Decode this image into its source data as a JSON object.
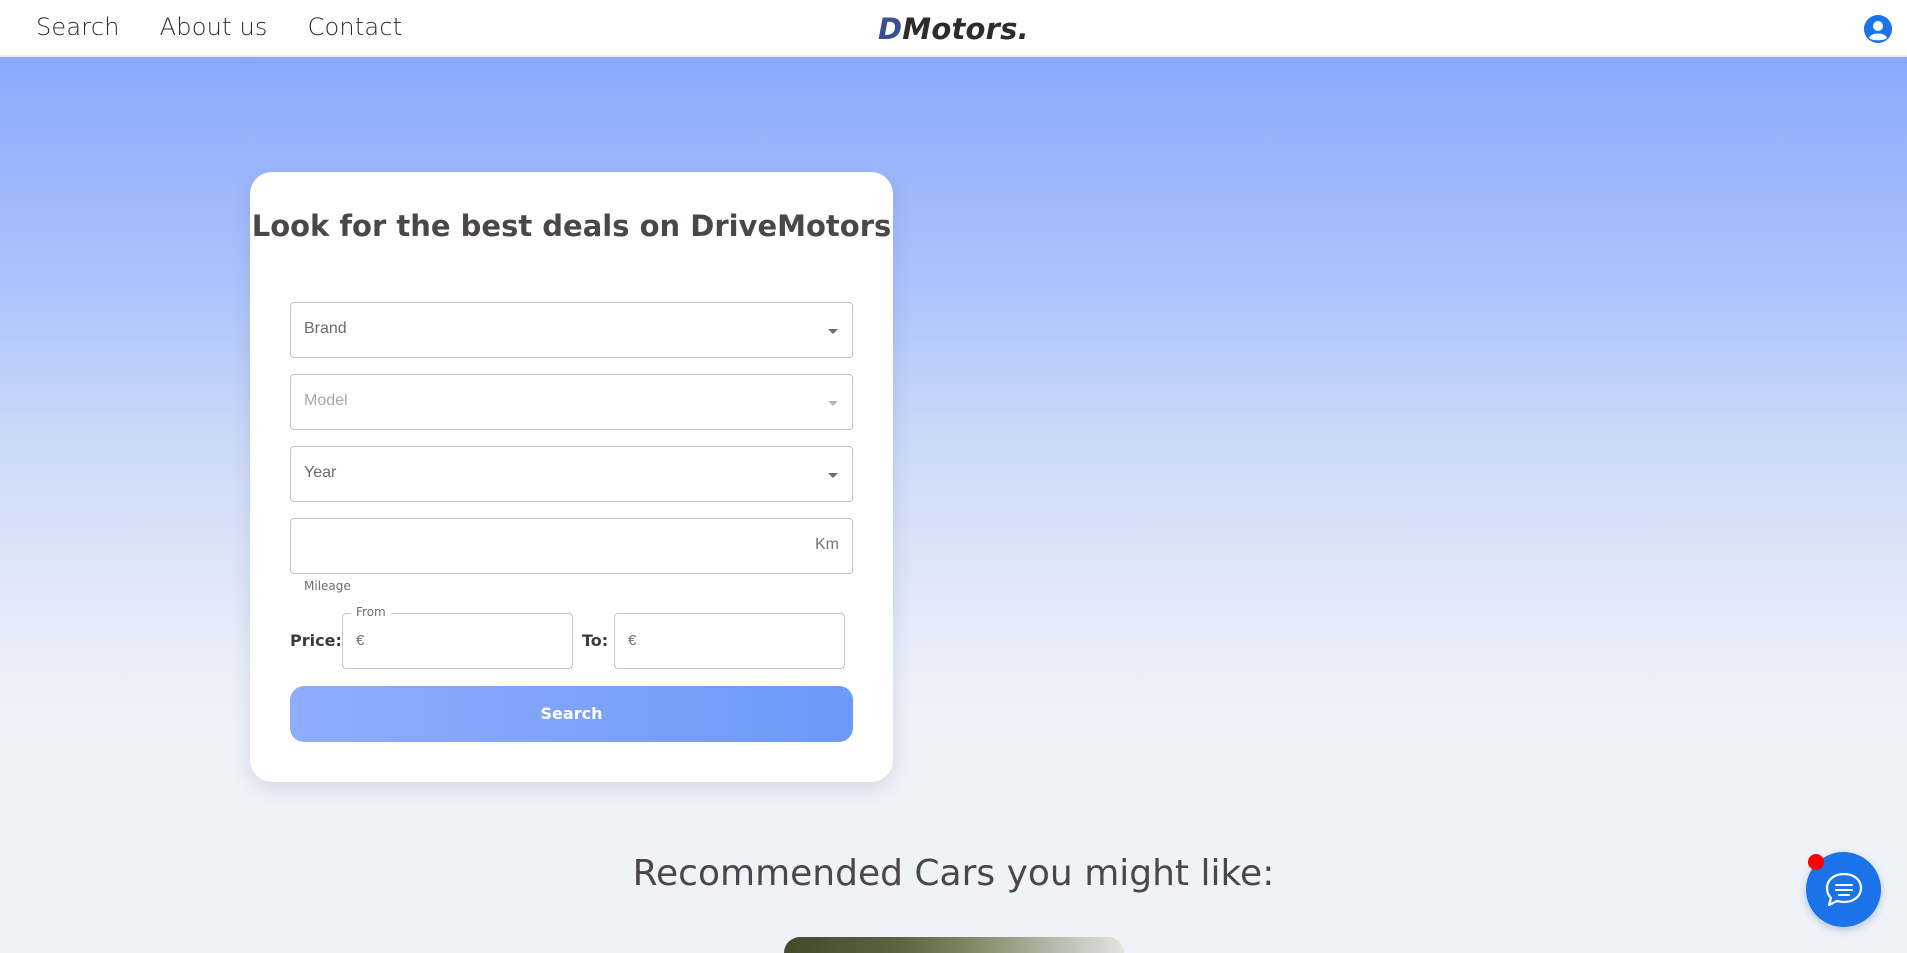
{
  "nav": {
    "links": [
      "Search",
      "About us",
      "Contact"
    ],
    "logo_mark": "D",
    "logo_text": "Motors."
  },
  "search_card": {
    "title": "Look for the best deals on DriveMotors",
    "brand_label": "Brand",
    "model_label": "Model",
    "year_label": "Year",
    "mileage_unit": "Km",
    "mileage_helper": "Mileage",
    "price_label": "Price:",
    "from_legend": "From",
    "currency_symbol": "€",
    "to_label": "To:",
    "search_button": "Search"
  },
  "recommended": {
    "title": "Recommended Cars you might like:"
  },
  "colors": {
    "accent_blue": "#1a73e8",
    "button_gradient_start": "#8fadfb",
    "button_gradient_end": "#6c99fa",
    "notification_dot": "#ff0000"
  },
  "icons": {
    "profile": "user-circle-icon",
    "chat": "chat-bubble-icon"
  }
}
